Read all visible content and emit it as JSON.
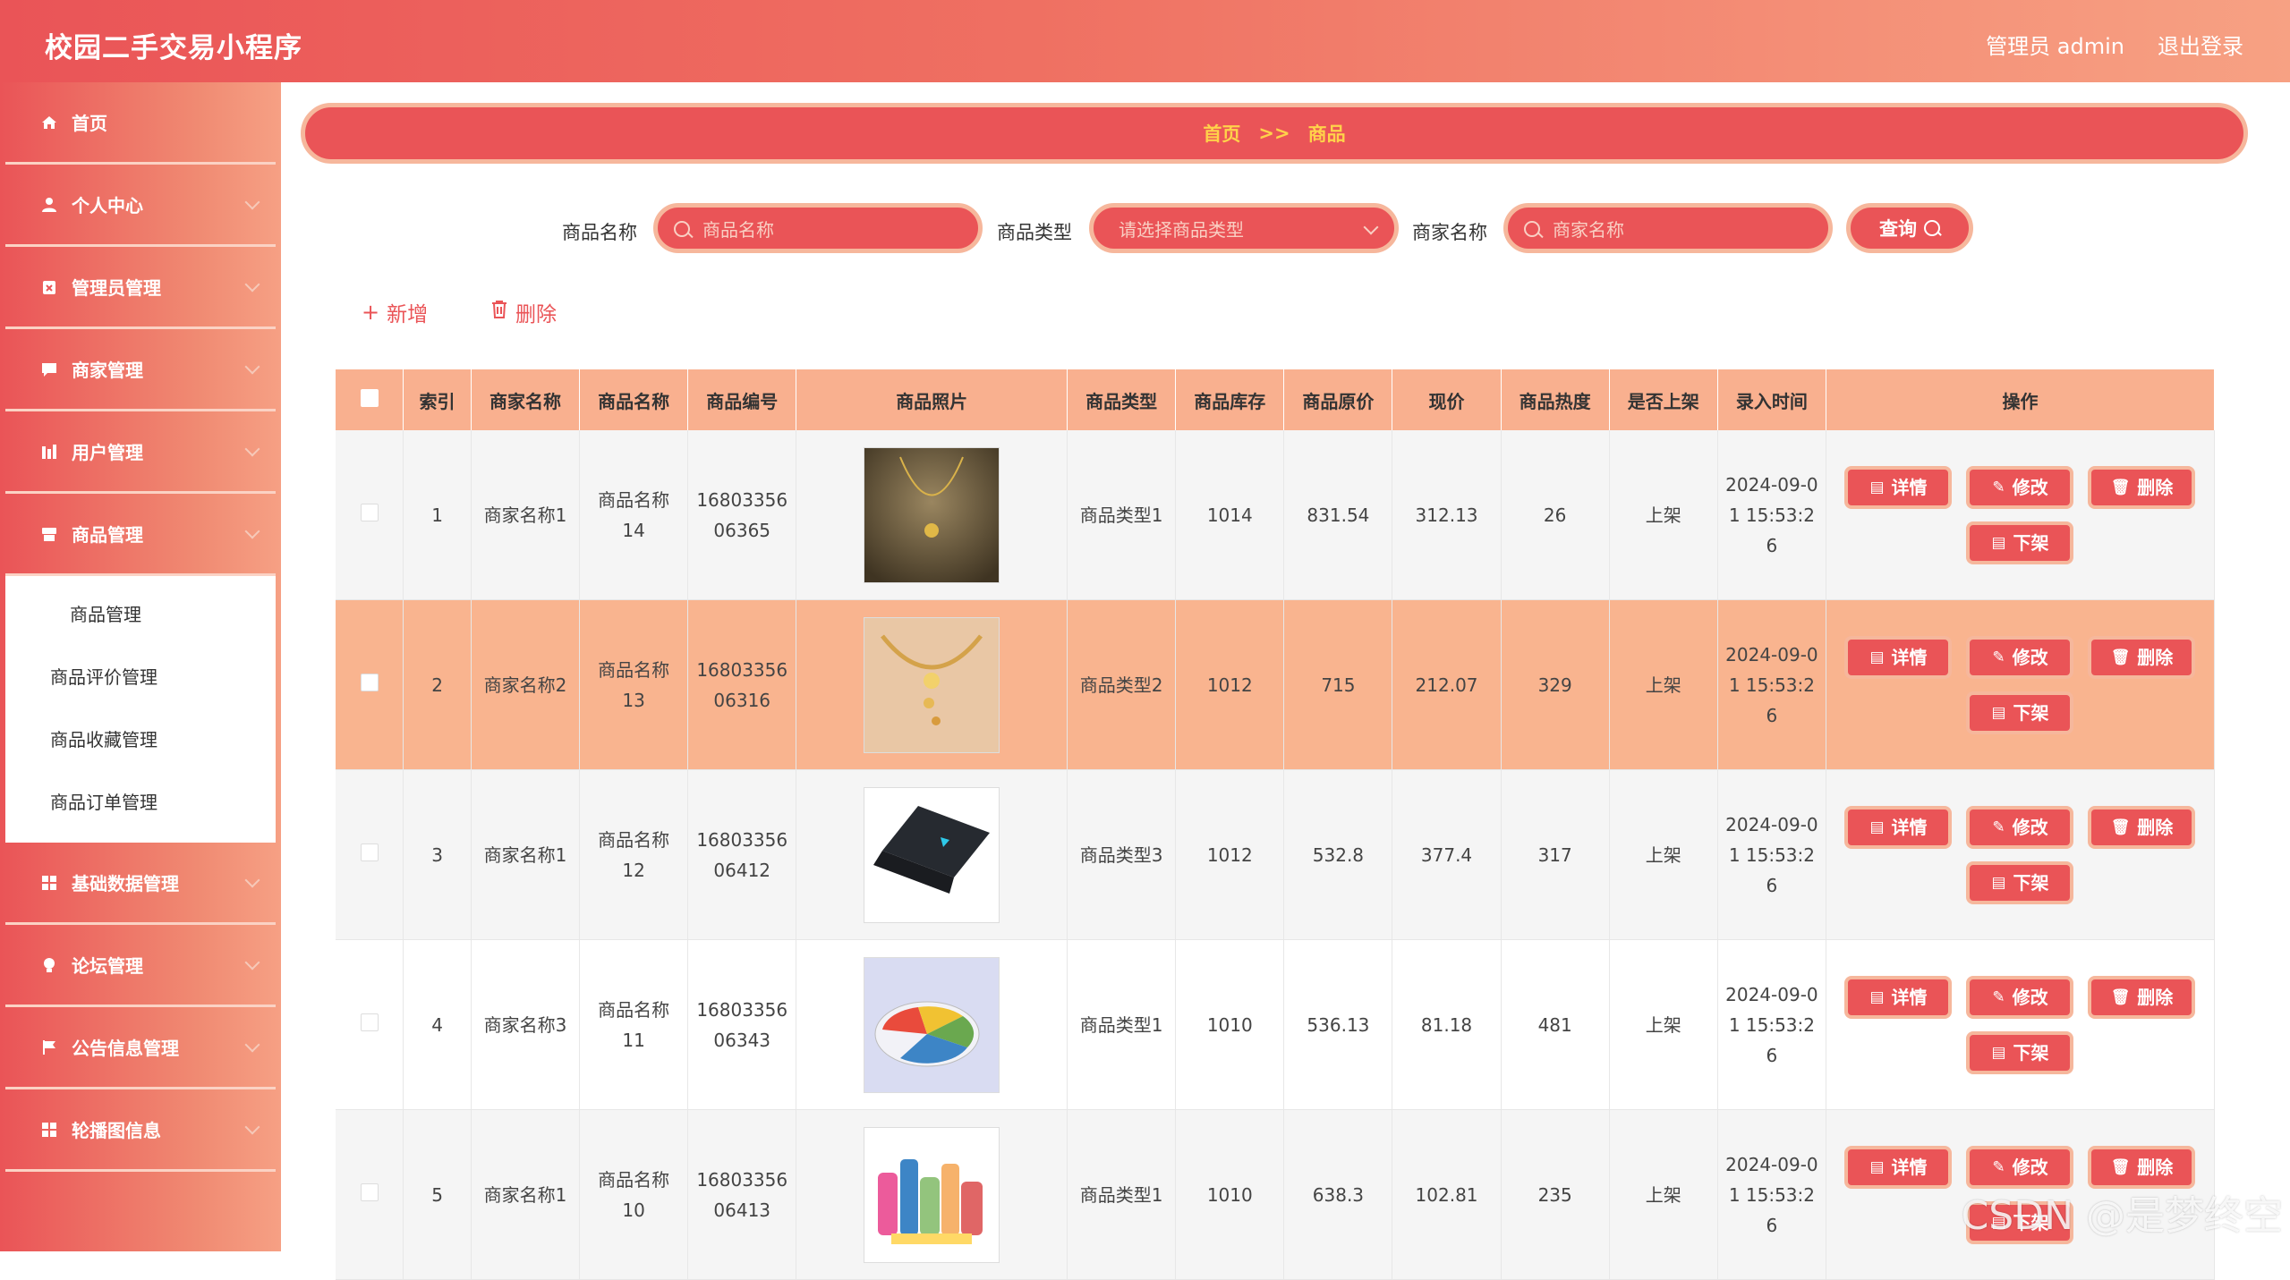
{
  "header": {
    "title": "校园二手交易小程序",
    "user": "管理员 admin",
    "logout": "退出登录"
  },
  "sidebar": {
    "items": [
      {
        "label": "首页",
        "icon": "home-icon"
      },
      {
        "label": "个人中心",
        "icon": "user-icon"
      },
      {
        "label": "管理员管理",
        "icon": "admin-icon"
      },
      {
        "label": "商家管理",
        "icon": "chat-icon"
      },
      {
        "label": "用户管理",
        "icon": "chart-icon"
      },
      {
        "label": "商品管理",
        "icon": "box-icon"
      },
      {
        "label": "基础数据管理",
        "icon": "grid-icon"
      },
      {
        "label": "论坛管理",
        "icon": "bulb-icon"
      },
      {
        "label": "公告信息管理",
        "icon": "flag-icon"
      },
      {
        "label": "轮播图信息",
        "icon": "grid-icon"
      }
    ],
    "submenu": [
      "商品管理",
      "商品评价管理",
      "商品收藏管理",
      "商品订单管理"
    ]
  },
  "breadcrumb": {
    "home": "首页",
    "sep": ">>",
    "current": "商品"
  },
  "search": {
    "name_label": "商品名称",
    "name_placeholder": "商品名称",
    "type_label": "商品类型",
    "type_placeholder": "请选择商品类型",
    "merchant_label": "商家名称",
    "merchant_placeholder": "商家名称",
    "query": "查询"
  },
  "toolbar": {
    "add": "新增",
    "delete": "删除"
  },
  "table": {
    "headers": [
      "索引",
      "商家名称",
      "商品名称",
      "商品编号",
      "商品照片",
      "商品类型",
      "商品库存",
      "商品原价",
      "现价",
      "商品热度",
      "是否上架",
      "录入时间",
      "操作"
    ],
    "actions": {
      "detail": "详情",
      "edit": "修改",
      "delete": "删除",
      "offshelf": "下架"
    },
    "rows": [
      {
        "index": "1",
        "merchant": "商家名称1",
        "name": "商品名称14",
        "code": "1680335606365",
        "photo": "necklace",
        "type": "商品类型1",
        "stock": "1014",
        "orig": "831.54",
        "price": "312.13",
        "heat": "26",
        "shelf": "上架",
        "time": "2024-09-01 15:53:26"
      },
      {
        "index": "2",
        "merchant": "商家名称2",
        "name": "商品名称13",
        "code": "1680335606316",
        "photo": "jewelry",
        "type": "商品类型2",
        "stock": "1012",
        "orig": "715",
        "price": "212.07",
        "heat": "329",
        "shelf": "上架",
        "time": "2024-09-01 15:53:26"
      },
      {
        "index": "3",
        "merchant": "商家名称1",
        "name": "商品名称12",
        "code": "1680335606412",
        "photo": "laptop",
        "type": "商品类型3",
        "stock": "1012",
        "orig": "532.8",
        "price": "377.4",
        "heat": "317",
        "shelf": "上架",
        "time": "2024-09-01 15:53:26"
      },
      {
        "index": "4",
        "merchant": "商家名称3",
        "name": "商品名称11",
        "code": "1680335606343",
        "photo": "food-box",
        "type": "商品类型1",
        "stock": "1010",
        "orig": "536.13",
        "price": "81.18",
        "heat": "481",
        "shelf": "上架",
        "time": "2024-09-01 15:53:26"
      },
      {
        "index": "5",
        "merchant": "商家名称1",
        "name": "商品名称10",
        "code": "1680335606413",
        "photo": "cleaning",
        "type": "商品类型1",
        "stock": "1010",
        "orig": "638.3",
        "price": "102.81",
        "heat": "235",
        "shelf": "上架",
        "time": "2024-09-01 15:53:26"
      }
    ]
  },
  "watermark": "CSDN @是梦终空"
}
